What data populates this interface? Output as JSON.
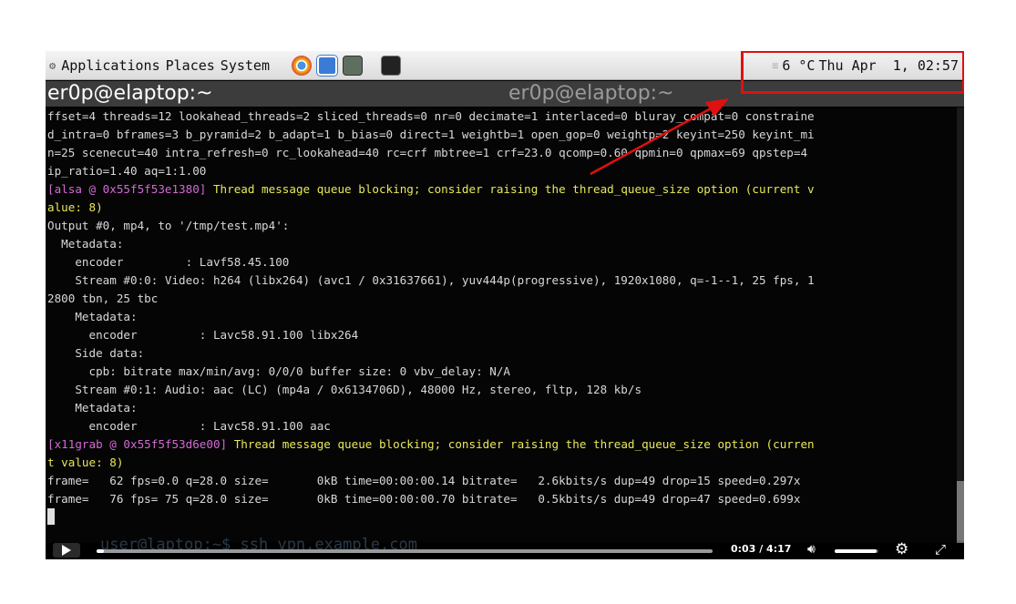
{
  "top_panel": {
    "menus": [
      "Applications",
      "Places",
      "System"
    ],
    "launchers": [
      "chrome-icon",
      "chat-icon",
      "calculator-icon",
      "terminal-icon"
    ],
    "temperature": "6 °C",
    "clock": "Thu Apr  1, 02:57"
  },
  "tabs": [
    {
      "title": "er0p@elaptop:~",
      "active": true
    },
    {
      "title": "er0p@elaptop:~",
      "active": false
    }
  ],
  "terminal": {
    "lines": [
      {
        "text": "ffset=4 threads=12 lookahead_threads=2 sliced_threads=0 nr=0 decimate=1 interlaced=0 bluray_compat=0 constraine"
      },
      {
        "text": "d_intra=0 bframes=3 b_pyramid=2 b_adapt=1 b_bias=0 direct=1 weightb=1 open_gop=0 weightp=2 keyint=250 keyint_mi"
      },
      {
        "text": "n=25 scenecut=40 intra_refresh=0 rc_lookahead=40 rc=crf mbtree=1 crf=23.0 qcomp=0.60 qpmin=0 qpmax=69 qpstep=4"
      },
      {
        "text": "ip_ratio=1.40 aq=1:1.00"
      },
      {
        "prefix": "[alsa @ 0x55f5f53e1380]",
        "text": " Thread message queue blocking; consider raising the thread_queue_size option (current v"
      },
      {
        "text": "alue: 8)",
        "warn": true
      },
      {
        "text": "Output #0, mp4, to '/tmp/test.mp4':"
      },
      {
        "text": "  Metadata:"
      },
      {
        "text": "    encoder         : Lavf58.45.100"
      },
      {
        "text": "    Stream #0:0: Video: h264 (libx264) (avc1 / 0x31637661), yuv444p(progressive), 1920x1080, q=-1--1, 25 fps, 1"
      },
      {
        "text": "2800 tbn, 25 tbc"
      },
      {
        "text": "    Metadata:"
      },
      {
        "text": "      encoder         : Lavc58.91.100 libx264"
      },
      {
        "text": "    Side data:"
      },
      {
        "text": "      cpb: bitrate max/min/avg: 0/0/0 buffer size: 0 vbv_delay: N/A"
      },
      {
        "text": "    Stream #0:1: Audio: aac (LC) (mp4a / 0x6134706D), 48000 Hz, stereo, fltp, 128 kb/s"
      },
      {
        "text": "    Metadata:"
      },
      {
        "text": "      encoder         : Lavc58.91.100 aac"
      },
      {
        "prefix": "[x11grab @ 0x55f5f53d6e00]",
        "text": " Thread message queue blocking; consider raising the thread_queue_size option (curren"
      },
      {
        "text": "t value: 8)",
        "warn": true
      },
      {
        "text": "frame=   62 fps=0.0 q=28.0 size=       0kB time=00:00:00.14 bitrate=   2.6kbits/s dup=49 drop=15 speed=0.297x"
      },
      {
        "text": "frame=   76 fps= 75 q=28.0 size=       0kB time=00:00:00.70 bitrate=   0.5kbits/s dup=49 drop=47 speed=0.699x"
      }
    ]
  },
  "player": {
    "time_display": "0:03 / 4:17",
    "progress": 0.012,
    "volume": 0.95,
    "background_text": "user@laptop:~$ ssh vpn.example.com"
  },
  "colors": {
    "annotation": "#e01010",
    "terminal_bg": "#050505",
    "warning_text": "#e8e85a",
    "context_prefix": "#d36ad6"
  }
}
